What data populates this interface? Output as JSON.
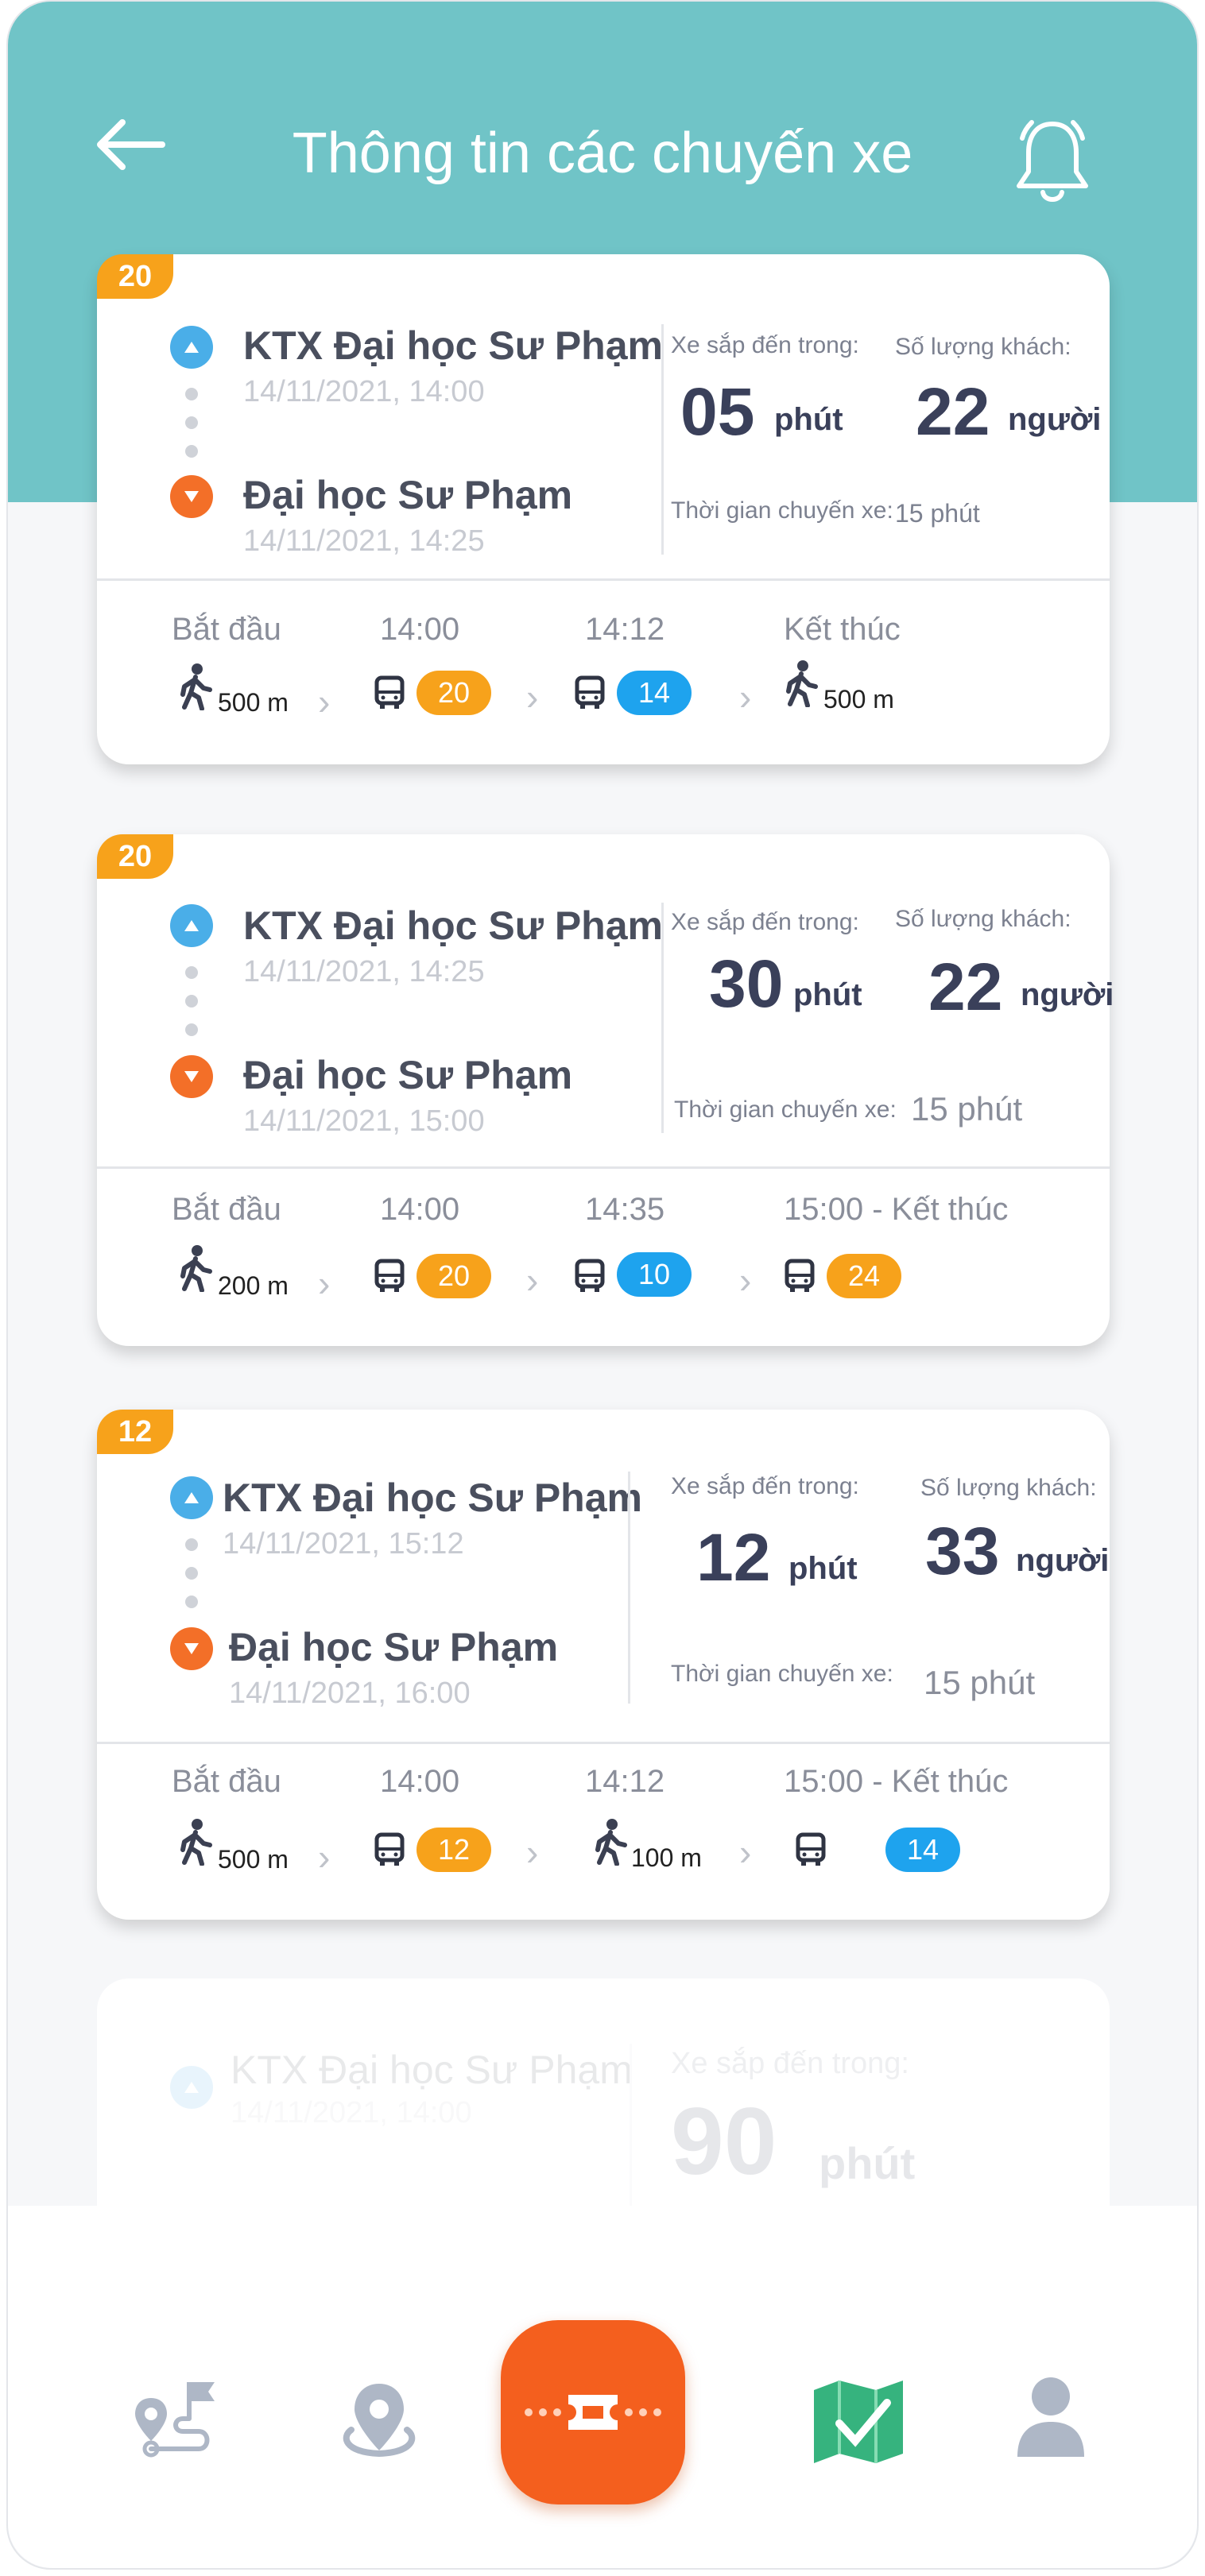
{
  "header": {
    "title": "Thông tin các chuyến xe"
  },
  "labels": {
    "arriving_in": "Xe sắp đến trong:",
    "passengers": "Số lượng khách:",
    "trip_time": "Thời gian chuyến xe:",
    "minutes": "phút",
    "people": "người",
    "start": "Bắt đầu",
    "end": "Kết thúc"
  },
  "trips": [
    {
      "route": "20",
      "from": {
        "name": "KTX Đại học Sư Phạm",
        "time": "14/11/2021, 14:00"
      },
      "to": {
        "name": "Đại học Sư Phạm",
        "time": "14/11/2021, 14:25"
      },
      "arrive_minutes": "05",
      "passengers": "22",
      "duration": "15 phút",
      "timeline": {
        "labels": [
          "Bắt đầu",
          "14:00",
          "14:12",
          "Kết thúc"
        ],
        "walk_start": "500 m",
        "bus1": "20",
        "bus2": "14",
        "walk_end": "500 m"
      }
    },
    {
      "route": "20",
      "from": {
        "name": "KTX Đại học Sư Phạm",
        "time": "14/11/2021, 14:25"
      },
      "to": {
        "name": "Đại học Sư Phạm",
        "time": "14/11/2021, 15:00"
      },
      "arrive_minutes": "30",
      "passengers": "22",
      "duration": "15 phút",
      "timeline": {
        "labels": [
          "Bắt đầu",
          "14:00",
          "14:35",
          "15:00 - Kết thúc"
        ],
        "walk_start": "200 m",
        "bus1": "20",
        "bus2": "10",
        "bus3": "24"
      }
    },
    {
      "route": "12",
      "from": {
        "name": "KTX Đại học Sư Phạm",
        "time": "14/11/2021, 15:12"
      },
      "to": {
        "name": "Đại học Sư Phạm",
        "time": "14/11/2021, 16:00"
      },
      "arrive_minutes": "12",
      "passengers": "33",
      "duration": "15 phút",
      "timeline": {
        "labels": [
          "Bắt đầu",
          "14:00",
          "14:12",
          "15:00 - Kết thúc"
        ],
        "walk_start": "500 m",
        "bus1": "12",
        "walk_mid": "100 m",
        "bus2": "14"
      }
    },
    {
      "from": {
        "name": "KTX Đại học Sư Phạm",
        "time": "14/11/2021, 14:00"
      },
      "arrive_minutes": "90"
    }
  ],
  "nav": {
    "items": [
      "route-planner-icon",
      "map-pin-icon",
      "ticket-icon",
      "map-icon",
      "user-icon"
    ]
  },
  "colors": {
    "header": "#70c4c7",
    "orange": "#f7a21b",
    "blue": "#1ea3ee",
    "accent": "#f45f1e"
  }
}
